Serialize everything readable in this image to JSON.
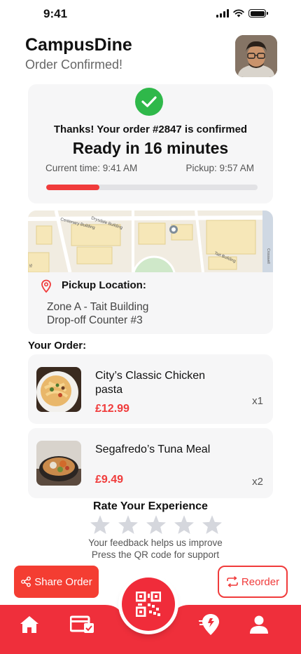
{
  "status_bar": {
    "time": "9:41"
  },
  "header": {
    "title": "CampusDine",
    "subtitle": "Order Confirmed!"
  },
  "confirmation": {
    "message": "Thanks! Your order #2847 is confirmed",
    "ready": "Ready in 16 minutes",
    "current_time": "Current time: 9:41 AM",
    "pickup_time": "Pickup: 9:57 AM",
    "progress_fraction": 0.25
  },
  "location": {
    "map_labels": [
      "Centenary Building",
      "Drysdale Building",
      "Tait Building",
      "Crosswell",
      "St"
    ],
    "label": "Pickup Location:",
    "line1": "Zone A - Tait Building",
    "line2": "Drop-off Counter #3"
  },
  "order": {
    "title": "Your Order:",
    "items": [
      {
        "name": "City’s Classic Chicken pasta",
        "price": "£12.99",
        "qty": "x1"
      },
      {
        "name": "Segafredo’s Tuna Meal",
        "price": "£9.49",
        "qty": "x2"
      }
    ]
  },
  "rating": {
    "title": "Rate Your Experience",
    "stars_total": 5,
    "stars_selected": 0,
    "line1": "Your feedback helps us improve",
    "line2": "Press the QR code for support"
  },
  "actions": {
    "share_label": "Share Order",
    "reorder_label": "Reorder"
  },
  "nav": {
    "items": [
      "home-icon",
      "wallet-icon",
      "qr-code-icon",
      "location-pin-icon",
      "profile-icon"
    ]
  },
  "colors": {
    "accent": "#f03b3b",
    "success": "#2fb84a",
    "card": "#f6f6f7"
  }
}
